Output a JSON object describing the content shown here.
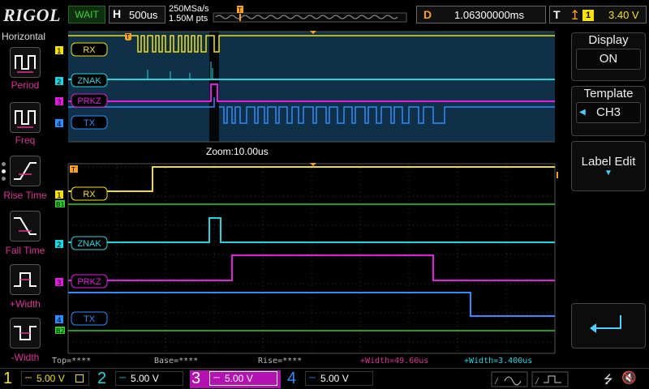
{
  "topbar": {
    "logo": "RIGOL",
    "run_status": "WAIT",
    "horizontal_label": "H",
    "timebase": "500us",
    "sample_rate": "250MSa/s",
    "memory_depth": "1.50M pts",
    "delay_label": "D",
    "delay_value": "1.06300000ms",
    "trigger_label": "T",
    "trigger_source": "1",
    "trigger_level": "3.40 V"
  },
  "left_menu": {
    "title": "Horizontal",
    "items": [
      "Period",
      "Freq",
      "Rise Time",
      "Fall Time",
      "+Width",
      "-Width"
    ]
  },
  "right_menu": {
    "display_title": "Display",
    "display_value": "ON",
    "template_title": "Template",
    "template_value": "CH3",
    "label_edit": "Label Edit"
  },
  "waveform": {
    "zoom_label": "Zoom:10.00us",
    "labels": [
      "RX",
      "ZNAK",
      "PRKZ",
      "TX"
    ],
    "marker_b1": "B1",
    "marker_b2": "B2"
  },
  "measurements": {
    "top": "Top=****",
    "base": "Base=****",
    "rise": "Rise=****",
    "pwidth": "+Width=49.60us",
    "pwidth2": "+Width=3.400us"
  },
  "channels": [
    {
      "num": "1",
      "scale": "5.00 V",
      "color": "#f5e10a"
    },
    {
      "num": "2",
      "scale": "5.00 V",
      "color": "#1fd6e0"
    },
    {
      "num": "3",
      "scale": "5.00 V",
      "color": "#e21ce0"
    },
    {
      "num": "4",
      "scale": "5.00 V",
      "color": "#2f8cff"
    }
  ],
  "colors": {
    "ch1": "#f5e10a",
    "ch2": "#1fd6e0",
    "ch3": "#e21ce0",
    "ch4": "#2f8cff",
    "bus": "#2bd12b",
    "trigger": "#f8a020",
    "measure": "#e0309a",
    "overview_bg": "#0f3046"
  },
  "icons": [
    "period-icon",
    "freq-icon",
    "rise-time-icon",
    "fall-time-icon",
    "pos-width-icon",
    "neg-width-icon",
    "return-icon",
    "usb-icon",
    "speaker-icon"
  ]
}
